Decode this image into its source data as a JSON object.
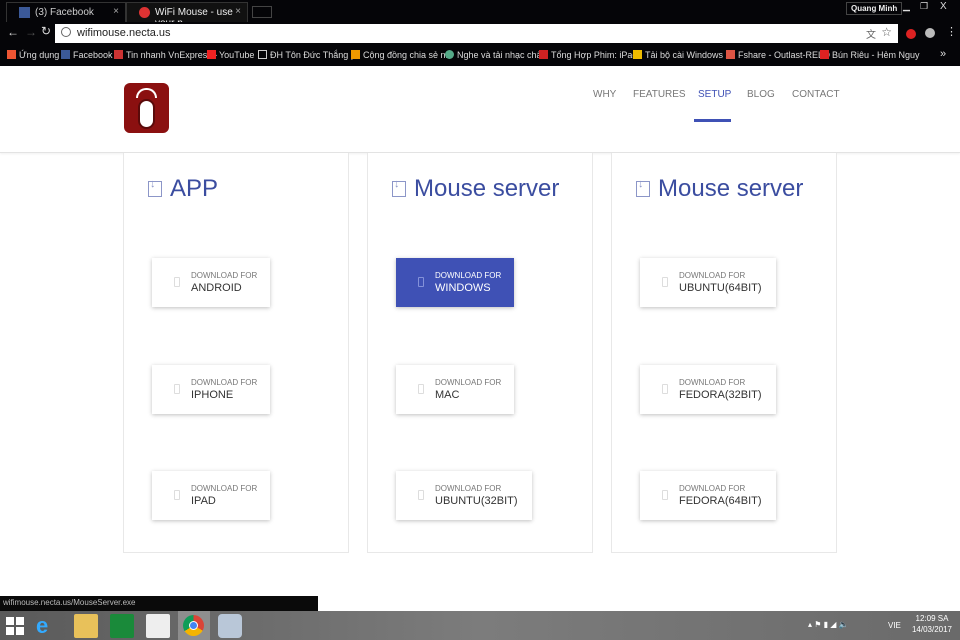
{
  "browser": {
    "tabs": [
      {
        "title": "(3) Facebook",
        "icon": "facebook-icon"
      },
      {
        "title": "WiFi Mouse - use your p",
        "icon": "apple-icon"
      }
    ],
    "profile": "Quang Minh",
    "url": "wifimouse.necta.us",
    "bookmarks": [
      "Ứng dụng",
      "Facebook",
      "Tin nhanh VnExpress -",
      "YouTube",
      "ĐH Tôn Đức Thắng |",
      "Cộng đồng chia sẻ nh",
      "Nghe và tải nhạc chất",
      "Tổng Hợp Phim: iPad/",
      "Tải bộ cài Windows X",
      "Fshare - Outlast-RELO",
      "Bún Riêu - Hẻm Nguy"
    ],
    "bookmark_overflow": "»",
    "extensions": [
      "ABP"
    ]
  },
  "site": {
    "nav": [
      {
        "label": "WHY"
      },
      {
        "label": "FEATURES"
      },
      {
        "label": "SETUP",
        "active": true
      },
      {
        "label": "BLOG"
      },
      {
        "label": "CONTACT"
      }
    ],
    "accent": "#3f51b5",
    "columns": [
      {
        "title": "APP",
        "buttons": [
          {
            "small": "DOWNLOAD FOR",
            "label": "ANDROID"
          },
          {
            "small": "DOWNLOAD FOR",
            "label": "IPHONE"
          },
          {
            "small": "DOWNLOAD FOR",
            "label": "IPAD"
          }
        ]
      },
      {
        "title": "Mouse server",
        "buttons": [
          {
            "small": "DOWNLOAD FOR",
            "label": "WINDOWS",
            "primary": true
          },
          {
            "small": "DOWNLOAD FOR",
            "label": "MAC"
          },
          {
            "small": "DOWNLOAD FOR",
            "label": "UBUNTU(32BIT)"
          }
        ]
      },
      {
        "title": "Mouse server",
        "buttons": [
          {
            "small": "DOWNLOAD FOR",
            "label": "UBUNTU(64BIT)"
          },
          {
            "small": "DOWNLOAD FOR",
            "label": "FEDORA(32BIT)"
          },
          {
            "small": "DOWNLOAD FOR",
            "label": "FEDORA(64BIT)"
          }
        ]
      }
    ]
  },
  "status_url": "wifimouse.necta.us/MouseServer.exe",
  "taskbar": {
    "lang": "VIE",
    "time": "12:09 SA",
    "date": "14/03/2017"
  }
}
